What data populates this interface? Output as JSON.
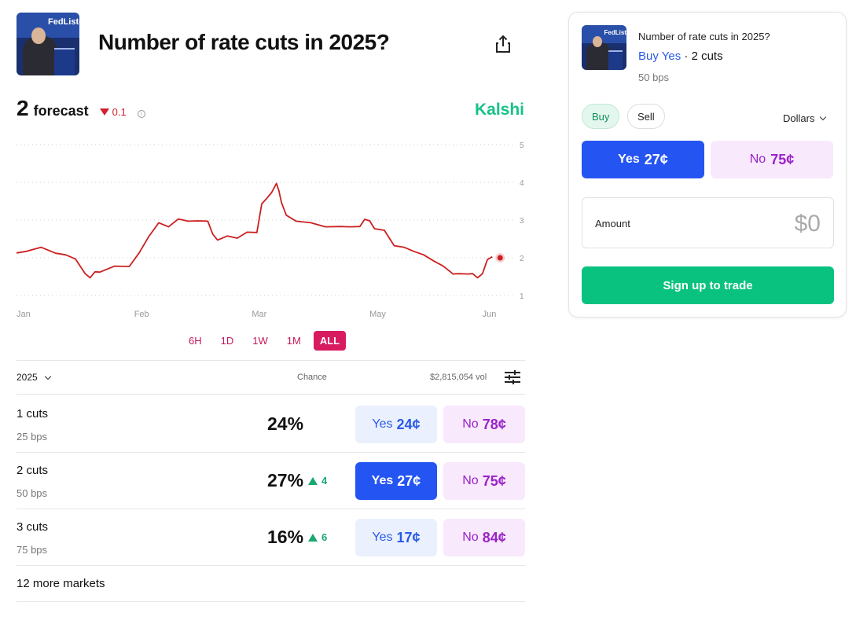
{
  "market": {
    "title": "Number of rate cuts in 2025?",
    "thumb_text": "FedListen"
  },
  "forecast": {
    "value": "2",
    "label": "forecast",
    "delta": "0.1",
    "delta_direction": "down"
  },
  "brand": "Kalshi",
  "chart_data": {
    "type": "line",
    "x_ticks": [
      "Jan",
      "Feb",
      "Mar",
      "May",
      "Jun"
    ],
    "y_ticks": [
      1,
      2,
      3,
      4,
      5
    ],
    "ylim": [
      1,
      5
    ],
    "grid": "dotted horizontal",
    "y_axis_side": "right",
    "series": [
      {
        "color": "#cc1f1f",
        "x": [
          0,
          0.02,
          0.05,
          0.08,
          0.1,
          0.12,
          0.14,
          0.15,
          0.16,
          0.17,
          0.2,
          0.23,
          0.25,
          0.27,
          0.29,
          0.31,
          0.33,
          0.35,
          0.37,
          0.39,
          0.4,
          0.41,
          0.43,
          0.45,
          0.47,
          0.49,
          0.5,
          0.51,
          0.52,
          0.53,
          0.535,
          0.54,
          0.55,
          0.57,
          0.6,
          0.63,
          0.66,
          0.68,
          0.7,
          0.71,
          0.72,
          0.73,
          0.75,
          0.77,
          0.79,
          0.81,
          0.83,
          0.85,
          0.87,
          0.89,
          0.9,
          0.92,
          0.93,
          0.94,
          0.95,
          0.96,
          0.97
        ],
        "y": [
          2.1,
          2.2,
          2.25,
          2.15,
          2.05,
          2.0,
          1.55,
          1.5,
          1.6,
          1.65,
          1.75,
          1.8,
          2.1,
          2.6,
          2.9,
          2.85,
          3.0,
          3.0,
          2.95,
          3.0,
          2.6,
          2.5,
          2.55,
          2.55,
          2.65,
          2.7,
          3.4,
          3.6,
          3.7,
          4.0,
          3.75,
          3.5,
          3.1,
          3.0,
          2.9,
          2.85,
          2.8,
          2.85,
          2.8,
          3.05,
          2.95,
          2.8,
          2.7,
          2.35,
          2.25,
          2.2,
          2.05,
          1.95,
          1.75,
          1.6,
          1.55,
          1.6,
          1.55,
          1.5,
          1.55,
          1.98,
          2.0
        ]
      }
    ]
  },
  "ranges": [
    "6H",
    "1D",
    "1W",
    "1M",
    "ALL"
  ],
  "active_range": "ALL",
  "table": {
    "year": "2025",
    "chance_header": "Chance",
    "volume": "$2,815,054 vol",
    "rows": [
      {
        "title": "1 cuts",
        "bps": "25 bps",
        "chance": "24%",
        "delta": "",
        "yes_label": "Yes",
        "yes_price": "24¢",
        "no_label": "No",
        "no_price": "78¢"
      },
      {
        "title": "2 cuts",
        "bps": "50 bps",
        "chance": "27%",
        "delta": "4",
        "yes_label": "Yes",
        "yes_price": "27¢",
        "no_label": "No",
        "no_price": "75¢"
      },
      {
        "title": "3 cuts",
        "bps": "75 bps",
        "chance": "16%",
        "delta": "6",
        "yes_label": "Yes",
        "yes_price": "17¢",
        "no_label": "No",
        "no_price": "84¢"
      }
    ],
    "more_markets": "12 more markets"
  },
  "panel": {
    "title": "Number of rate cuts in 2025?",
    "buy_yes": "Buy Yes",
    "separator": " · ",
    "selection": "2 cuts",
    "bps": "50 bps",
    "buy_label": "Buy",
    "sell_label": "Sell",
    "currency": "Dollars",
    "yes_label": "Yes",
    "yes_price": "27¢",
    "no_label": "No",
    "no_price": "75¢",
    "amount_label": "Amount",
    "amount_value": "$0",
    "signup_label": "Sign up to trade"
  },
  "colors": {
    "brand": "#17c287",
    "line": "#cc1f1f",
    "yes": "#2454f2",
    "no": "#9a22c9",
    "range_active": "#d81b60",
    "signup": "#0ac27f"
  }
}
